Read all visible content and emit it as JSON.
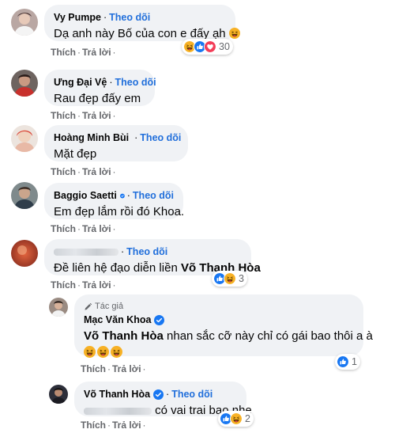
{
  "follow_label": "Theo dõi",
  "like_label": "Thích",
  "reply_label": "Trả lời",
  "separator": "·",
  "author_tag": "Tác giả",
  "comments": [
    {
      "name": "Vy Pumpe",
      "text": "Dạ anh này Bố của con e đấy ạh",
      "reaction_count": "30",
      "reactions": [
        "haha",
        "like",
        "love"
      ]
    },
    {
      "name": "Ưng Đại Vệ",
      "text": "Rau đẹp đấy em"
    },
    {
      "name": "Hoàng Minh Bùi",
      "verified": true,
      "text": "Mặt đẹp"
    },
    {
      "name": "Baggio Saetti",
      "verified": true,
      "text": "Em đẹp lắm rồi đó Khoa."
    },
    {
      "name": "",
      "text_prefix": "Đề liên hệ đạo diễn liền",
      "mention": "Võ Thanh Hòa",
      "reaction_count": "3",
      "reactions": [
        "like",
        "haha"
      ]
    },
    {
      "name": "Mạc Văn Khoa",
      "verified": true,
      "is_author": true,
      "mention": "Võ Thanh Hòa",
      "text_suffix": "nhan sắc cỡ này chỉ có gái bao thôi a à",
      "reaction_count": "1",
      "reactions": [
        "like"
      ]
    },
    {
      "name": "Võ Thanh Hòa",
      "verified": true,
      "text_suffix": "có vai trai bao nhe",
      "reaction_count": "2",
      "reactions": [
        "like",
        "haha"
      ]
    }
  ],
  "colors": {
    "bubble": "#f0f2f5",
    "link": "#216fdb",
    "meta": "#65676b",
    "like": "#1877f2",
    "love": "#f33e58",
    "haha": "#f7b125"
  },
  "icons": [
    "verified-badge-icon",
    "pencil-icon",
    "like-reaction-icon",
    "haha-reaction-icon",
    "love-reaction-icon"
  ]
}
